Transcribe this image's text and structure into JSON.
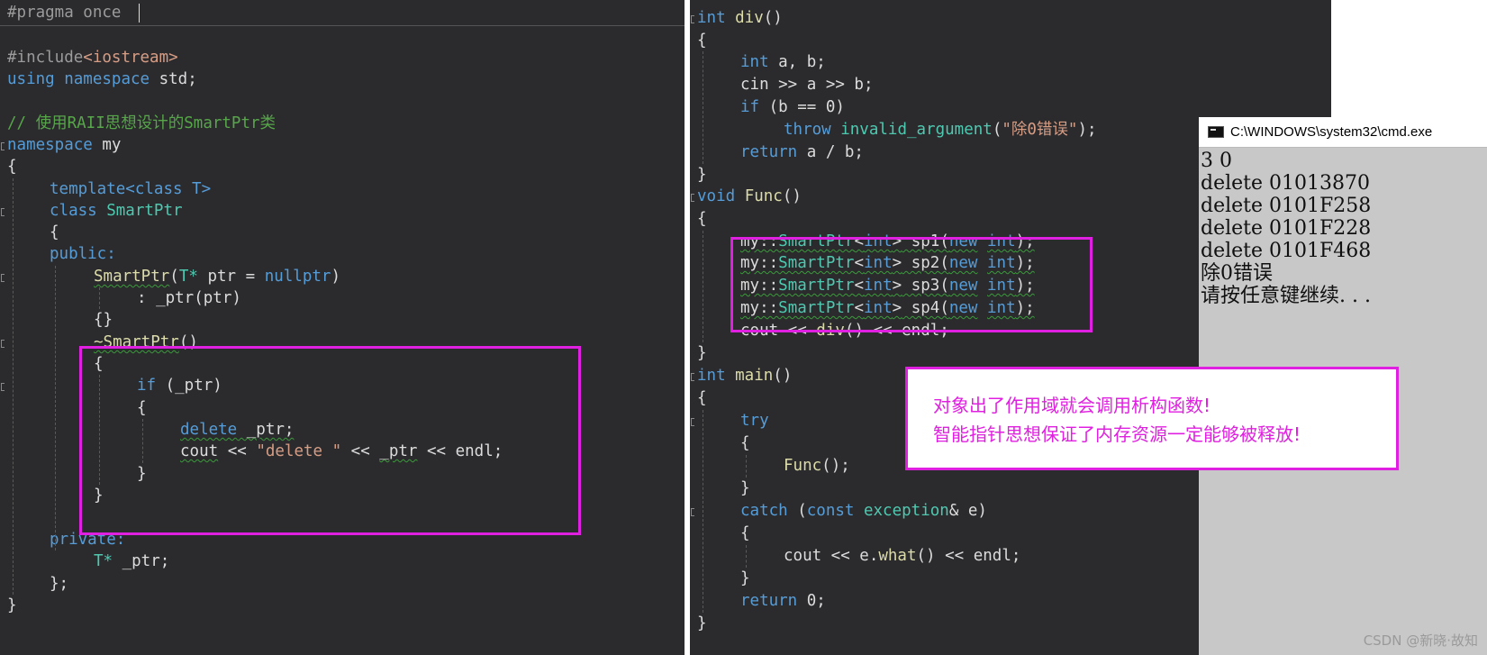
{
  "left_editor": {
    "first_line": "#pragma once",
    "include_directive": "#include",
    "include_header": "<iostream>",
    "using_kw": "using",
    "namespace_kw": "namespace",
    "std_text": " std;",
    "comment": "// 使用RAII思想设计的SmartPtr类",
    "ns_name": " my",
    "template_kw": "template",
    "template_args": "<class T>",
    "class_kw": "class",
    "class_name": " SmartPtr",
    "public_label": "public:",
    "ctor_name": "SmartPtr",
    "ctor_params_open": "(",
    "ctor_param_type": "T*",
    "ctor_param_rest": " ptr = ",
    "nullptr_kw": "nullptr",
    "ctor_params_close": ")",
    "init_list": ": _ptr(ptr)",
    "empty_body": "{}",
    "dtor_name": "~SmartPtr",
    "dtor_parens": "()",
    "if_kw": "if",
    "if_cond": " (_ptr)",
    "delete_kw": "delete",
    "delete_arg": " _ptr;",
    "cout_text": "cout",
    "cout_op1": " << ",
    "delete_str": "\"delete \"",
    "cout_op2": " << ",
    "cout_ptr": "_ptr",
    "cout_op3": " << ",
    "endl_text": "endl;",
    "private_label": "private:",
    "member_type": "T*",
    "member_name": " _ptr;",
    "close_class": "};",
    "brace_open": "{",
    "brace_close": "}"
  },
  "right_editor": {
    "int_kw": "int",
    "div_name": " div",
    "parens": "()",
    "decl_ab": " a, b;",
    "cin_line": "cin >> a >> b;",
    "if_kw": "if",
    "if_cond": " (b == 0)",
    "throw_kw": "throw",
    "exc_type": " invalid_argument",
    "exc_open": "(",
    "exc_msg": "\"除0错误\"",
    "exc_close": ");",
    "return_kw": "return",
    "return_expr": " a / b;",
    "void_kw": "void",
    "func_name": " Func",
    "sp_ns": "my::",
    "sp_type": "SmartPtr",
    "sp_tmpl_open": "<",
    "sp_tmpl_int": "int",
    "sp_tmpl_close": ">",
    "sp_names": [
      " sp1",
      " sp2",
      " sp3",
      " sp4"
    ],
    "new_kw": "new",
    "sp_tail": ");",
    "cout_div_a": "cout << ",
    "cout_div_fn": "div",
    "cout_div_b": "() << endl;",
    "main_name": " main",
    "try_kw": "try",
    "func_call": "Func",
    "func_call_tail": "();",
    "catch_kw": "catch",
    "catch_open": " (",
    "const_kw": "const",
    "exception_type": " exception",
    "catch_rest": "& e)",
    "cout_what_a": "cout << e.",
    "what_fn": "what",
    "cout_what_b": "() << endl;",
    "return_zero": " 0;",
    "brace_open": "{",
    "brace_close": "}",
    "space_paren": " (",
    "semi_close": ");"
  },
  "console": {
    "title": "C:\\WINDOWS\\system32\\cmd.exe",
    "lines": [
      "3 0",
      "delete 01013870",
      "delete 0101F258",
      "delete 0101F228",
      "delete 0101F468",
      "除0错误",
      "请按任意键继续. . ."
    ]
  },
  "annotation": {
    "line1": "对象出了作用域就会调用析构函数!",
    "line2": "智能指针思想保证了内存资源一定能够被释放!"
  },
  "watermark": "CSDN @新晓·故知",
  "colors": {
    "editor_bg": "#2b2b2e",
    "keyword": "#569cd6",
    "type": "#4ec9b0",
    "function": "#dcdcaa",
    "string": "#d69d85",
    "comment": "#57a64a",
    "highlight_box": "#e020e0"
  }
}
